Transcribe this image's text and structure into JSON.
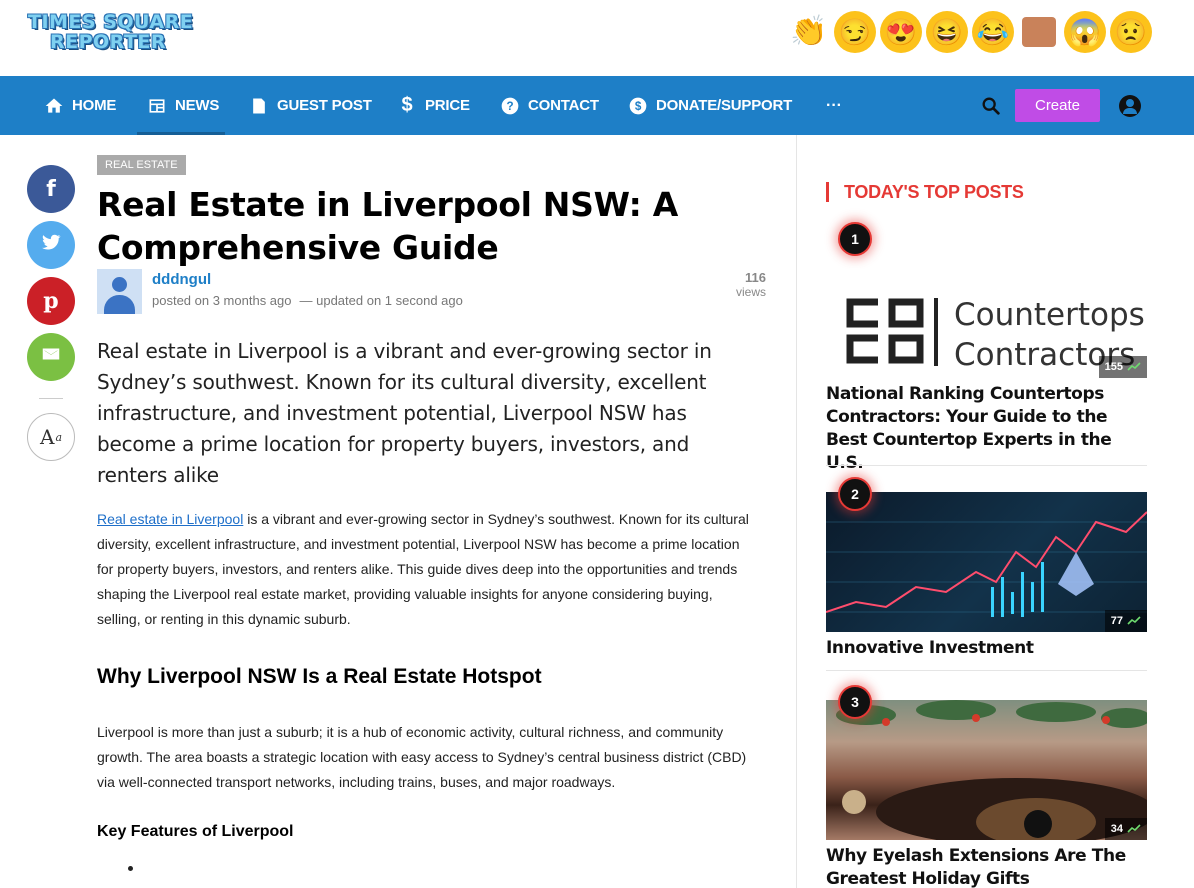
{
  "site": {
    "logo_line1": "TIMES SQUARE",
    "logo_line2": "REPORTER"
  },
  "reactions": [
    {
      "name": "clap-reaction",
      "glyph": "👏"
    },
    {
      "name": "smirk-reaction",
      "glyph": "😏"
    },
    {
      "name": "heart-eyes-reaction",
      "glyph": "😍"
    },
    {
      "name": "laugh-reaction",
      "glyph": "😆"
    },
    {
      "name": "joy-reaction",
      "glyph": "😂"
    },
    {
      "name": "thumbs-down-reaction",
      "glyph": ""
    },
    {
      "name": "scream-reaction",
      "glyph": "😱"
    },
    {
      "name": "worried-reaction",
      "glyph": "😟"
    }
  ],
  "nav": {
    "items": [
      {
        "label": "HOME",
        "icon": "home-icon"
      },
      {
        "label": "NEWS",
        "icon": "newspaper-icon"
      },
      {
        "label": "GUEST POST",
        "icon": "document-icon"
      },
      {
        "label": "PRICE",
        "icon": "dollar-icon"
      },
      {
        "label": "CONTACT",
        "icon": "help-icon"
      },
      {
        "label": "DONATE/SUPPORT",
        "icon": "donate-icon"
      }
    ],
    "more": "···",
    "create_label": "Create"
  },
  "article": {
    "category": "REAL ESTATE",
    "title": "Real Estate in Liverpool NSW: A Comprehensive Guide",
    "author": "dddngul",
    "posted": "posted on 3 months ago",
    "updated": "— updated on 1 second ago",
    "views_count": "116",
    "views_label": "views",
    "lead": "Real estate in Liverpool is a vibrant and ever-growing sector in Sydney’s southwest. Known for its cultural diversity, excellent infrastructure, and investment potential, Liverpool NSW has become a prime location for property buyers, investors, and renters alike",
    "para1_link": "Real estate in Liverpool",
    "para1_rest": " is a vibrant and ever-growing sector in Sydney’s southwest. Known for its cultural diversity, excellent infrastructure, and investment potential, Liverpool NSW has become a prime location for property buyers, investors, and renters alike. This guide dives deep into the opportunities and trends shaping the Liverpool real estate market, providing valuable insights for anyone considering buying, selling, or renting in this dynamic suburb.",
    "heading2": "Why Liverpool NSW Is a Real Estate Hotspot",
    "para2": "Liverpool is more than just a suburb; it is a hub of economic activity, cultural richness, and community growth. The area boasts a strategic location with easy access to Sydney’s central business district (CBD) via well-connected transport networks, including trains, buses, and major roadways.",
    "heading3": "Key Features of Liverpool"
  },
  "font_toggle": {
    "big": "A",
    "small": "a"
  },
  "sidebar": {
    "title": "TODAY'S TOP POSTS",
    "posts": [
      {
        "rank": "1",
        "count": "155",
        "title": "National Ranking Countertops Contractors: Your Guide to the Best Countertop Experts in the U.S.",
        "img_line1": "Countertops",
        "img_line2": "Contractors"
      },
      {
        "rank": "2",
        "count": "77",
        "title": "Innovative Investment"
      },
      {
        "rank": "3",
        "count": "34",
        "title": "Why Eyelash Extensions Are The Greatest Holiday Gifts"
      }
    ]
  },
  "colors": {
    "nav_bg": "#1e7fc7",
    "create_btn": "#c04ce6",
    "accent_red": "#e53935",
    "link": "#1e6fc9"
  }
}
